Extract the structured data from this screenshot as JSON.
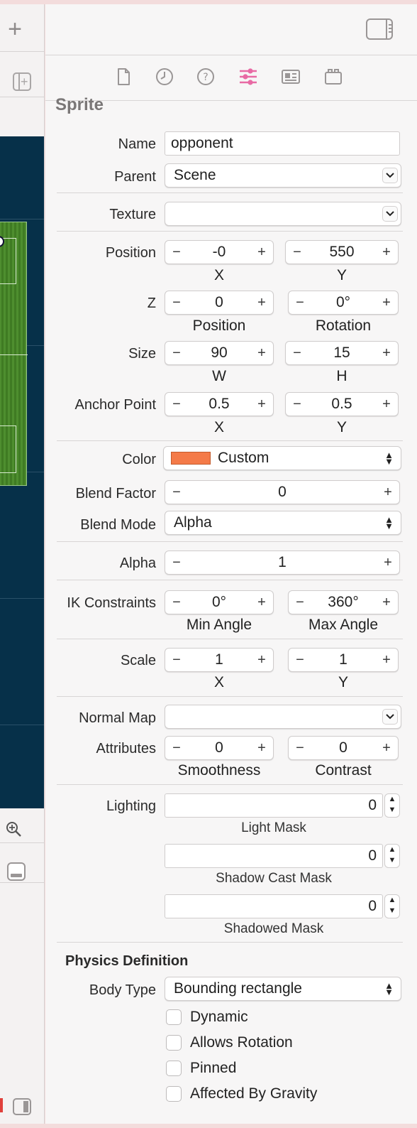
{
  "inspector": {
    "section_title": "Sprite",
    "name": {
      "label": "Name",
      "value": "opponent"
    },
    "parent": {
      "label": "Parent",
      "value": "Scene"
    },
    "texture": {
      "label": "Texture",
      "value": ""
    },
    "position": {
      "label": "Position",
      "x": "-0",
      "y": "550",
      "x_label": "X",
      "y_label": "Y"
    },
    "z": {
      "label": "Z",
      "position": "0",
      "rotation": "0°",
      "position_label": "Position",
      "rotation_label": "Rotation"
    },
    "size": {
      "label": "Size",
      "w": "90",
      "h": "15",
      "w_label": "W",
      "h_label": "H"
    },
    "anchor": {
      "label": "Anchor Point",
      "x": "0.5",
      "y": "0.5",
      "x_label": "X",
      "y_label": "Y"
    },
    "color": {
      "label": "Color",
      "value": "Custom",
      "swatch": "#f47a48"
    },
    "blend_factor": {
      "label": "Blend Factor",
      "value": "0"
    },
    "blend_mode": {
      "label": "Blend Mode",
      "value": "Alpha"
    },
    "alpha": {
      "label": "Alpha",
      "value": "1"
    },
    "ik": {
      "label": "IK Constraints",
      "min": "0°",
      "max": "360°",
      "min_label": "Min Angle",
      "max_label": "Max Angle"
    },
    "scale": {
      "label": "Scale",
      "x": "1",
      "y": "1",
      "x_label": "X",
      "y_label": "Y"
    },
    "normal_map": {
      "label": "Normal Map",
      "value": ""
    },
    "attributes": {
      "label": "Attributes",
      "smoothness": "0",
      "contrast": "0",
      "smoothness_label": "Smoothness",
      "contrast_label": "Contrast"
    },
    "lighting": {
      "label": "Lighting",
      "light_mask": "0",
      "light_mask_label": "Light Mask",
      "shadow_cast_mask": "0",
      "shadow_cast_mask_label": "Shadow Cast Mask",
      "shadowed_mask": "0",
      "shadowed_mask_label": "Shadowed Mask"
    },
    "physics": {
      "title": "Physics Definition",
      "body_type_label": "Body Type",
      "body_type": "Bounding rectangle",
      "dynamic": "Dynamic",
      "allows_rotation": "Allows Rotation",
      "pinned": "Pinned",
      "affected_by_gravity": "Affected By Gravity"
    }
  },
  "toolbar": {
    "add_label": "+",
    "minus": "−",
    "plus": "+"
  },
  "colors": {
    "accent_tab": "#e86aa4",
    "scene_bg": "#063049"
  }
}
